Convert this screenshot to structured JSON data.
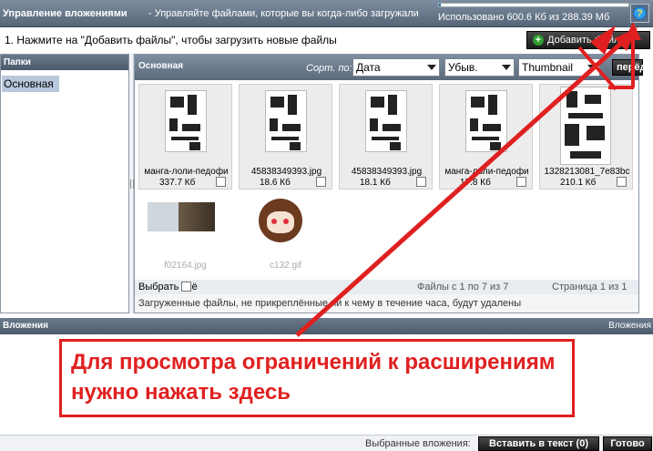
{
  "header": {
    "title": "Управление вложениями",
    "description": "- Управляйте файлами, которые вы когда-либо загружали",
    "quota_text": "Использовано 600.6 Кб из 288.39 Мб",
    "quota_fraction": 0.002,
    "help_label": "?"
  },
  "toolbar": {
    "instruction": "1. Нажмите на \"Добавить файлы\", чтобы загрузить новые файлы",
    "add_files_label": "Добавить файлы"
  },
  "folders": {
    "heading": "Папки",
    "items": [
      {
        "label": "Основная"
      }
    ]
  },
  "files": {
    "heading": "Основная",
    "sort_label": "Сорт. по:",
    "sort_field": "Дата",
    "sort_order": "Убыв.",
    "view_mode": "Thumbnail",
    "go_label": "перёд",
    "items": [
      {
        "name": "манга-лоли-педофи",
        "size": "337.7 Кб"
      },
      {
        "name": "45838349393.jpg",
        "size": "18.6 Кб"
      },
      {
        "name": "45838349393.jpg",
        "size": "18.1 Кб"
      },
      {
        "name": "манга-лоли-педофи",
        "size": "17.8 Кб"
      },
      {
        "name": "1328213081_7e83bc",
        "size": "210.1 Кб"
      },
      {
        "name": "f02164.jpg",
        "size": ""
      },
      {
        "name": "c132.gif",
        "size": ""
      }
    ],
    "select_all_label": "Выбрать всё",
    "count_text": "Файлы с 1 по 7 из 7",
    "page_text": "Страница 1 из 1",
    "notice": "Загруженные файлы, не прикреплённые ни к чему в течение часа, будут удалены"
  },
  "attachments": {
    "heading": "Вложения",
    "right_label": "Вложения"
  },
  "callout": {
    "text": "Для просмотра ограничений к расширениям нужно нажать здесь",
    "color": "#e02020"
  },
  "footer": {
    "selected_label": "Выбранные вложения:",
    "insert_label": "Вставить в текст (0)",
    "done_label": "Готово"
  }
}
